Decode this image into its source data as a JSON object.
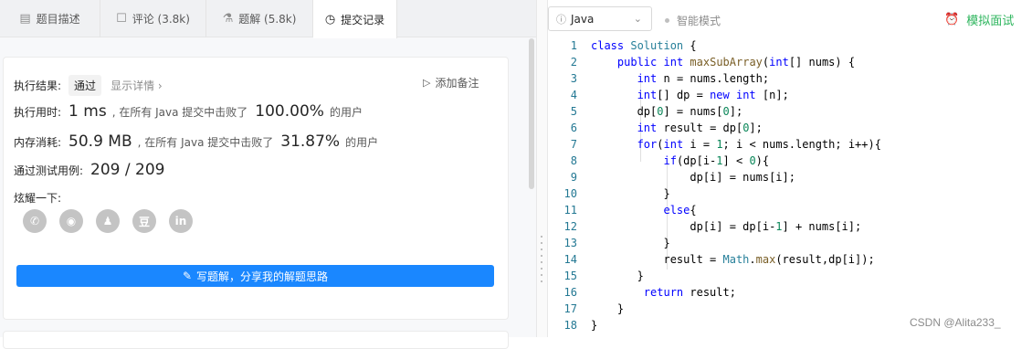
{
  "tabs": [
    {
      "label": "题目描述",
      "icon": "description-icon"
    },
    {
      "label": "评论 (3.8k)",
      "icon": "comment-icon"
    },
    {
      "label": "题解 (5.8k)",
      "icon": "flask-icon"
    },
    {
      "label": "提交记录",
      "icon": "clock-icon"
    }
  ],
  "result": {
    "label": "执行结果:",
    "status": "通过",
    "detail_link": "显示详情 ›",
    "add_note": "添加备注"
  },
  "runtime": {
    "label": "执行用时:",
    "value": "1 ms",
    "text1": ", 在所有 Java 提交中击败了",
    "percent": "100.00%",
    "text2": "的用户"
  },
  "memory": {
    "label": "内存消耗:",
    "value": "50.9 MB",
    "text1": ", 在所有 Java 提交中击败了",
    "percent": "31.87%",
    "text2": "的用户"
  },
  "tests": {
    "label": "通过测试用例:",
    "value": "209 / 209"
  },
  "share": {
    "label": "炫耀一下:",
    "icons": [
      "wechat-icon",
      "weibo-icon",
      "qq-icon",
      "douban-icon",
      "linkedin-icon"
    ],
    "glyphs": [
      "✆",
      "◉",
      "♟",
      "豆",
      "in"
    ]
  },
  "write_button": "写题解，分享我的解题思路",
  "editor": {
    "language": "Java",
    "smart_mode": "智能模式",
    "mock_interview": "模拟面试"
  },
  "code_lines": [
    "class Solution {",
    "    public int maxSubArray(int[] nums) {",
    "       int n = nums.length;",
    "       int[] dp = new int [n];",
    "       dp[0] = nums[0];",
    "       int result = dp[0];",
    "       for(int i = 1; i < nums.length; i++){",
    "           if(dp[i-1] < 0){",
    "               dp[i] = nums[i];",
    "           }",
    "           else{",
    "               dp[i] = dp[i-1] + nums[i];",
    "           }",
    "           result = Math.max(result,dp[i]);",
    "       }",
    "        return result;",
    "    }",
    "}"
  ],
  "watermark": "CSDN @Alita233_",
  "colors": {
    "accent": "#1a87ff",
    "green": "#2db55d",
    "keyword": "#0000ff",
    "type": "#267f99",
    "function": "#795e26",
    "number": "#098658"
  }
}
